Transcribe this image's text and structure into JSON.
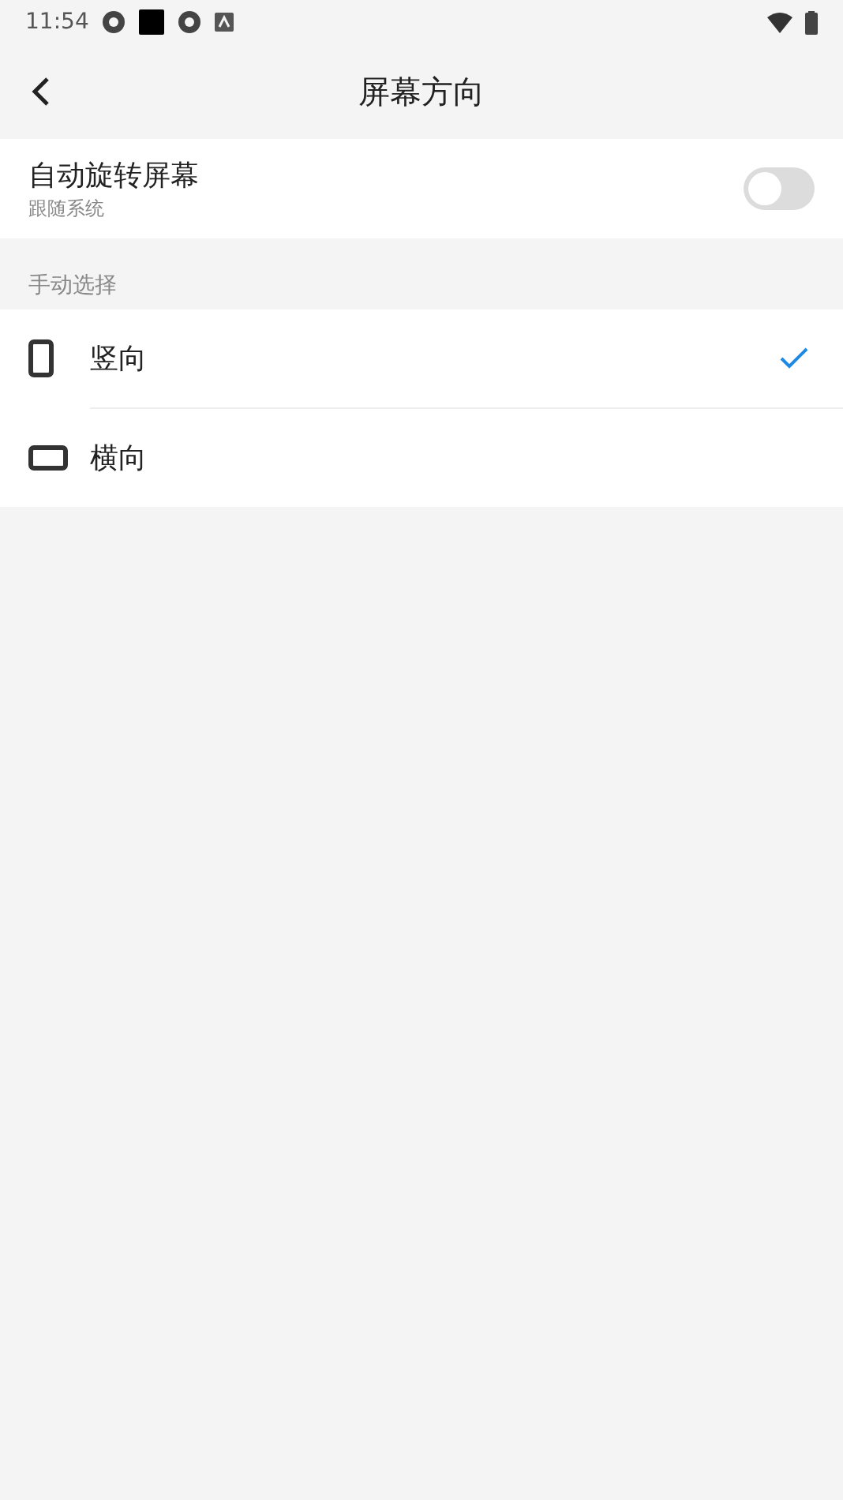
{
  "status_bar": {
    "time": "11:54"
  },
  "header": {
    "title": "屏幕方向"
  },
  "auto_rotate": {
    "label": "自动旋转屏幕",
    "subtitle": "跟随系统",
    "on": false
  },
  "section": {
    "label": "手动选择"
  },
  "options": [
    {
      "kind": "portrait",
      "label": "竖向",
      "selected": true
    },
    {
      "kind": "landscape",
      "label": "横向",
      "selected": false
    }
  ]
}
